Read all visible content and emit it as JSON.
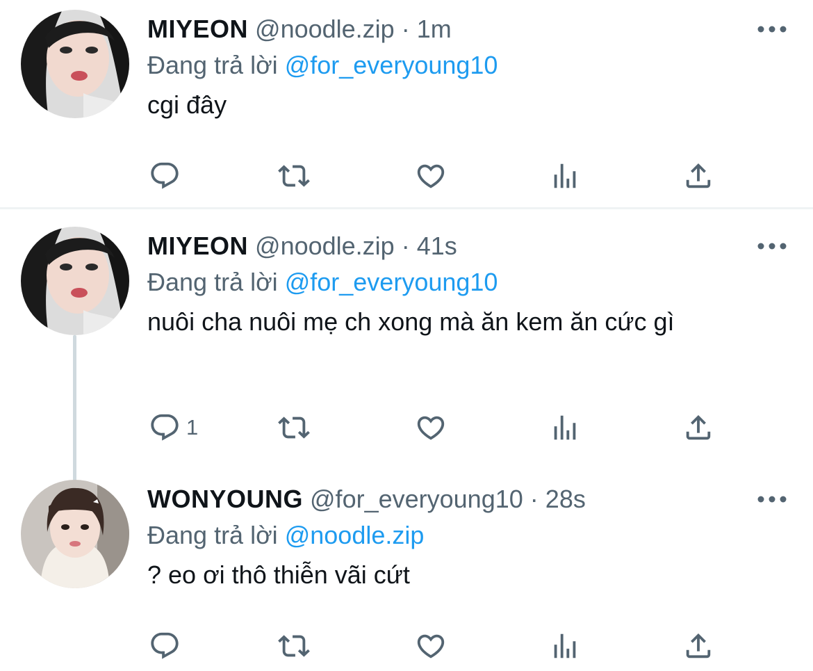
{
  "tweets": [
    {
      "display_name": "MIYEON",
      "handle": "@noodle.zip",
      "separator": "·",
      "time": "1m",
      "reply_prefix": "Đang trả lời",
      "reply_to": "@for_everyoung10",
      "text": "cgi đây",
      "reply_count": "",
      "avatar": "miyeon-avatar"
    },
    {
      "display_name": "MIYEON",
      "handle": "@noodle.zip",
      "separator": "·",
      "time": "41s",
      "reply_prefix": "Đang trả lời",
      "reply_to": "@for_everyoung10",
      "text": "nuôi cha nuôi mẹ ch xong mà ăn kem ăn cức gì",
      "reply_count": "1",
      "avatar": "miyeon-avatar"
    },
    {
      "display_name": "WONYOUNG",
      "handle": "@for_everyoung10",
      "separator": "·",
      "time": "28s",
      "reply_prefix": "Đang trả lời",
      "reply_to": "@noodle.zip",
      "text": "? eo ơi thô thiễn vãi cứt",
      "reply_count": "",
      "avatar": "wonyoung-avatar"
    }
  ],
  "icons": {
    "reply": "reply-icon",
    "retweet": "retweet-icon",
    "like": "heart-icon",
    "views": "analytics-icon",
    "share": "share-icon",
    "more": "more-icon"
  },
  "colors": {
    "accent": "#1d9bf0",
    "secondary_text": "#536471",
    "primary_text": "#0f1419",
    "divider": "#eff3f4",
    "thread_line": "#cfd9de"
  }
}
